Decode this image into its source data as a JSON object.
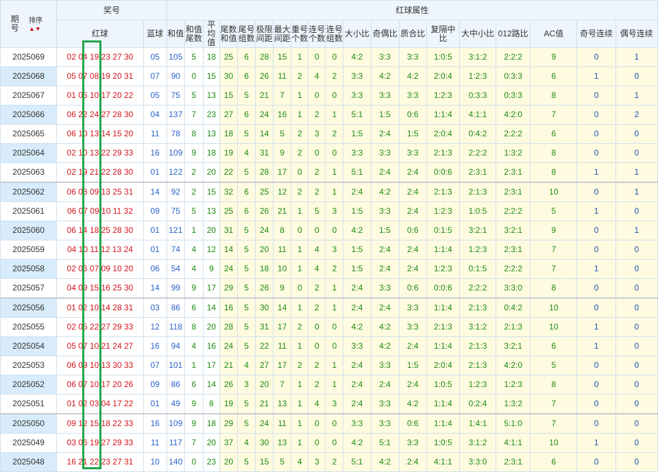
{
  "header": {
    "period_label": "期\n号",
    "sort_label": "排序",
    "prize_label": "奖号",
    "red_ball_label": "红球",
    "blue_ball_label": "蓝球",
    "attr_group_label": "红球属性",
    "attr_cols": [
      "和值",
      "和值尾数",
      "平均值",
      "尾数和值",
      "尾号组数",
      "极限间距",
      "最大间距",
      "重号个数",
      "连号个数",
      "连号组数",
      "大小比",
      "奇偶比",
      "质合比",
      "复隔中比",
      "大中小比",
      "012路比",
      "AC值",
      "奇号连续",
      "偶号连续"
    ]
  },
  "colors": {
    "red": "#d2131b",
    "blue": "#2a62c9",
    "green": "#1d8a12",
    "highlight": "#1fa64a"
  },
  "rows": [
    {
      "p": "2025069",
      "r": "02 04 19 23 27 30",
      "b": "05",
      "v": [
        "105",
        "5",
        "18",
        "25",
        "6",
        "28",
        "15",
        "1",
        "0",
        "0",
        "4:2",
        "3:3",
        "3:3",
        "1:0:5",
        "3:1:2",
        "2:2:2",
        "9",
        "0",
        "1"
      ]
    },
    {
      "p": "2025068",
      "r": "05 07 08 19 20 31",
      "b": "07",
      "v": [
        "90",
        "0",
        "15",
        "30",
        "6",
        "26",
        "11",
        "2",
        "4",
        "2",
        "3:3",
        "4:2",
        "4:2",
        "2:0:4",
        "1:2:3",
        "0:3:3",
        "6",
        "1",
        "0"
      ]
    },
    {
      "p": "2025067",
      "r": "01 05 10 17 20 22",
      "b": "05",
      "v": [
        "75",
        "5",
        "13",
        "15",
        "5",
        "21",
        "7",
        "1",
        "0",
        "0",
        "3:3",
        "3:3",
        "3:3",
        "1:2:3",
        "0:3:3",
        "0:3:3",
        "8",
        "0",
        "1"
      ]
    },
    {
      "p": "2025066",
      "r": "06 22 24 27 28 30",
      "b": "04",
      "v": [
        "137",
        "7",
        "23",
        "27",
        "6",
        "24",
        "16",
        "1",
        "2",
        "1",
        "5:1",
        "1:5",
        "0:6",
        "1:1:4",
        "4:1:1",
        "4:2:0",
        "7",
        "0",
        "2"
      ]
    },
    {
      "p": "2025065",
      "r": "06 10 13 14 15 20",
      "b": "11",
      "v": [
        "78",
        "8",
        "13",
        "18",
        "5",
        "14",
        "5",
        "2",
        "3",
        "2",
        "1:5",
        "2:4",
        "1:5",
        "2:0:4",
        "0:4:2",
        "2:2:2",
        "6",
        "0",
        "0"
      ]
    },
    {
      "p": "2025064",
      "r": "02 10 13 22 29 33",
      "b": "16",
      "v": [
        "109",
        "9",
        "18",
        "19",
        "4",
        "31",
        "9",
        "2",
        "0",
        "0",
        "3:3",
        "3:3",
        "3:3",
        "2:1:3",
        "2:2:2",
        "1:3:2",
        "8",
        "0",
        "0"
      ]
    },
    {
      "p": "2025063",
      "r": "02 19 21 22 28 30",
      "b": "01",
      "v": [
        "122",
        "2",
        "20",
        "22",
        "5",
        "28",
        "17",
        "0",
        "2",
        "1",
        "5:1",
        "2:4",
        "2:4",
        "0:0:6",
        "2:3:1",
        "2:3:1",
        "8",
        "1",
        "1"
      ]
    },
    {
      "p": "2025062",
      "r": "06 08 09 13 25 31",
      "b": "14",
      "v": [
        "92",
        "2",
        "15",
        "32",
        "6",
        "25",
        "12",
        "2",
        "2",
        "1",
        "2:4",
        "4:2",
        "2:4",
        "2:1:3",
        "2:1:3",
        "2:3:1",
        "10",
        "0",
        "1"
      ]
    },
    {
      "p": "2025061",
      "r": "06 07 09 10 11 32",
      "b": "09",
      "v": [
        "75",
        "5",
        "13",
        "25",
        "6",
        "26",
        "21",
        "1",
        "5",
        "3",
        "1:5",
        "3:3",
        "2:4",
        "1:2:3",
        "1:0:5",
        "2:2:2",
        "5",
        "1",
        "0"
      ]
    },
    {
      "p": "2025060",
      "r": "06 14 18 25 28 30",
      "b": "01",
      "v": [
        "121",
        "1",
        "20",
        "31",
        "5",
        "24",
        "8",
        "0",
        "0",
        "0",
        "4:2",
        "1:5",
        "0:6",
        "0:1:5",
        "3:2:1",
        "3:2:1",
        "9",
        "0",
        "1"
      ]
    },
    {
      "p": "2025059",
      "r": "04 10 11 12 13 24",
      "b": "01",
      "v": [
        "74",
        "4",
        "12",
        "14",
        "5",
        "20",
        "11",
        "1",
        "4",
        "3",
        "1:5",
        "2:4",
        "2:4",
        "1:1:4",
        "1:2:3",
        "2:3:1",
        "7",
        "0",
        "0"
      ]
    },
    {
      "p": "2025058",
      "r": "02 06 07 09 10 20",
      "b": "06",
      "v": [
        "54",
        "4",
        "9",
        "24",
        "5",
        "18",
        "10",
        "1",
        "4",
        "2",
        "1:5",
        "2:4",
        "2:4",
        "1:2:3",
        "0:1:5",
        "2:2:2",
        "7",
        "1",
        "0"
      ]
    },
    {
      "p": "2025057",
      "r": "04 09 15 16 25 30",
      "b": "14",
      "v": [
        "99",
        "9",
        "17",
        "29",
        "5",
        "26",
        "9",
        "0",
        "2",
        "1",
        "2:4",
        "3:3",
        "0:6",
        "0:0:6",
        "2:2:2",
        "3:3:0",
        "8",
        "0",
        "0"
      ]
    },
    {
      "p": "2025056",
      "r": "01 02 10 14 28 31",
      "b": "03",
      "v": [
        "86",
        "6",
        "14",
        "16",
        "5",
        "30",
        "14",
        "1",
        "2",
        "1",
        "2:4",
        "2:4",
        "3:3",
        "1:1:4",
        "2:1:3",
        "0:4:2",
        "10",
        "0",
        "0"
      ]
    },
    {
      "p": "2025055",
      "r": "02 05 22 27 29 33",
      "b": "12",
      "v": [
        "118",
        "8",
        "20",
        "28",
        "5",
        "31",
        "17",
        "2",
        "0",
        "0",
        "4:2",
        "4:2",
        "3:3",
        "2:1:3",
        "3:1:2",
        "2:1:3",
        "10",
        "1",
        "0"
      ]
    },
    {
      "p": "2025054",
      "r": "05 07 10 21 24 27",
      "b": "16",
      "v": [
        "94",
        "4",
        "16",
        "24",
        "5",
        "22",
        "11",
        "1",
        "0",
        "0",
        "3:3",
        "4:2",
        "2:4",
        "1:1:4",
        "2:1:3",
        "3:2:1",
        "6",
        "1",
        "0"
      ]
    },
    {
      "p": "2025053",
      "r": "06 09 10 13 30 33",
      "b": "07",
      "v": [
        "101",
        "1",
        "17",
        "21",
        "4",
        "27",
        "17",
        "2",
        "2",
        "1",
        "2:4",
        "3:3",
        "1:5",
        "2:0:4",
        "2:1:3",
        "4:2:0",
        "5",
        "0",
        "0"
      ]
    },
    {
      "p": "2025052",
      "r": "06 07 10 17 20 26",
      "b": "09",
      "v": [
        "86",
        "6",
        "14",
        "26",
        "3",
        "20",
        "7",
        "1",
        "2",
        "1",
        "2:4",
        "2:4",
        "2:4",
        "1:0:5",
        "1:2:3",
        "1:2:3",
        "8",
        "0",
        "0"
      ]
    },
    {
      "p": "2025051",
      "r": "01 02 03 04 17 22",
      "b": "01",
      "v": [
        "49",
        "9",
        "8",
        "19",
        "5",
        "21",
        "13",
        "1",
        "4",
        "3",
        "2:4",
        "3:3",
        "4:2",
        "1:1:4",
        "0:2:4",
        "1:3:2",
        "7",
        "0",
        "0"
      ]
    },
    {
      "p": "2025050",
      "r": "09 12 15 18 22 33",
      "b": "16",
      "v": [
        "109",
        "9",
        "18",
        "29",
        "5",
        "24",
        "11",
        "1",
        "0",
        "0",
        "3:3",
        "3:3",
        "0:6",
        "1:1:4",
        "1:4:1",
        "5:1:0",
        "7",
        "0",
        "0"
      ]
    },
    {
      "p": "2025049",
      "r": "03 06 19 27 29 33",
      "b": "11",
      "v": [
        "117",
        "7",
        "20",
        "37",
        "4",
        "30",
        "13",
        "1",
        "0",
        "0",
        "4:2",
        "5:1",
        "3:3",
        "1:0:5",
        "3:1:2",
        "4:1:1",
        "10",
        "1",
        "0"
      ]
    },
    {
      "p": "2025048",
      "r": "16 21 22 23 27 31",
      "b": "10",
      "v": [
        "140",
        "0",
        "23",
        "20",
        "5",
        "15",
        "5",
        "4",
        "3",
        "2",
        "5:1",
        "4:2",
        "2:4",
        "4:1:1",
        "3:3:0",
        "2:3:1",
        "6",
        "0",
        "0"
      ]
    }
  ]
}
